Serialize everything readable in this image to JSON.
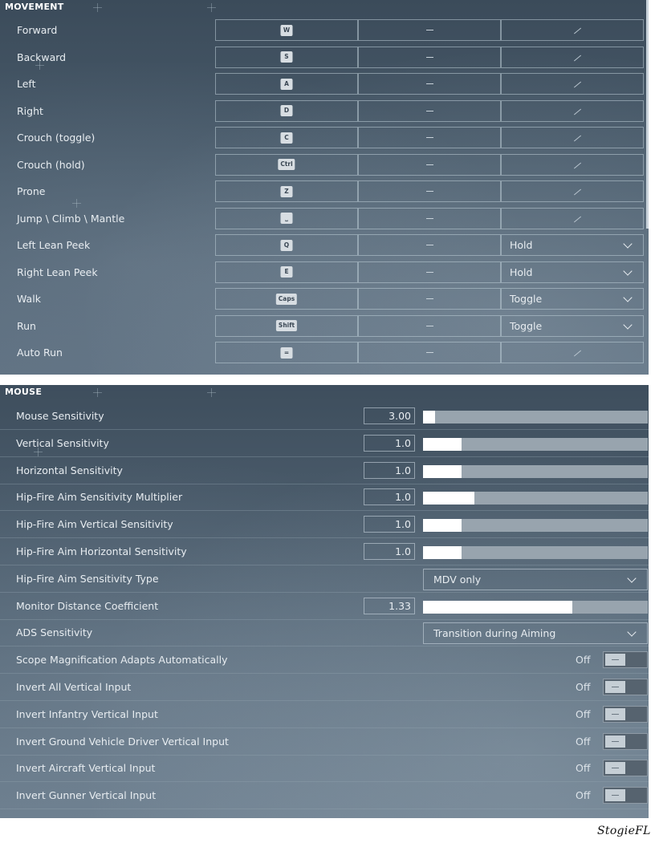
{
  "movement": {
    "title": "MOVEMENT",
    "rows": [
      {
        "label": "Forward",
        "key": "W",
        "secondary": "—",
        "third": "/"
      },
      {
        "label": "Backward",
        "key": "S",
        "secondary": "—",
        "third": "/"
      },
      {
        "label": "Left",
        "key": "A",
        "secondary": "—",
        "third": "/"
      },
      {
        "label": "Right",
        "key": "D",
        "secondary": "—",
        "third": "/"
      },
      {
        "label": "Crouch (toggle)",
        "key": "C",
        "secondary": "—",
        "third": "/"
      },
      {
        "label": "Crouch (hold)",
        "key": "Ctrl",
        "secondary": "—",
        "third": "/"
      },
      {
        "label": "Prone",
        "key": "Z",
        "secondary": "—",
        "third": "/"
      },
      {
        "label": "Jump \\ Climb \\ Mantle",
        "key": "⎵",
        "secondary": "—",
        "third": "/"
      },
      {
        "label": "Left Lean Peek",
        "key": "Q",
        "secondary": "—",
        "mode": "Hold"
      },
      {
        "label": "Right Lean Peek",
        "key": "E",
        "secondary": "—",
        "mode": "Hold"
      },
      {
        "label": "Walk",
        "key": "Caps",
        "secondary": "—",
        "mode": "Toggle"
      },
      {
        "label": "Run",
        "key": "Shift",
        "secondary": "—",
        "mode": "Toggle"
      },
      {
        "label": "Auto Run",
        "key": "=",
        "secondary": "—",
        "third": "/"
      }
    ]
  },
  "mouse": {
    "title": "MOUSE",
    "rows": [
      {
        "label": "Mouse Sensitivity",
        "value": "3.00",
        "level": 0.055
      },
      {
        "label": "Vertical Sensitivity",
        "value": "1.0",
        "level": 0.17
      },
      {
        "label": "Horizontal Sensitivity",
        "value": "1.0",
        "level": 0.17
      },
      {
        "label": "Hip-Fire Aim Sensitivity Multiplier",
        "value": "1.0",
        "level": 0.23
      },
      {
        "label": "Hip-Fire Aim Vertical Sensitivity",
        "value": "1.0",
        "level": 0.17
      },
      {
        "label": "Hip-Fire Aim Horizontal Sensitivity",
        "value": "1.0",
        "level": 0.17
      },
      {
        "label": "Hip-Fire Aim Sensitivity Type",
        "option": "MDV only"
      },
      {
        "label": "Monitor Distance Coefficient",
        "value": "1.33",
        "level": 0.665
      },
      {
        "label": "ADS Sensitivity",
        "option": "Transition during Aiming"
      },
      {
        "label": "Scope Magnification Adapts Automatically",
        "state": "Off"
      },
      {
        "label": "Invert All Vertical Input",
        "state": "Off"
      },
      {
        "label": "Invert Infantry Vertical Input",
        "state": "Off"
      },
      {
        "label": "Invert Ground Vehicle Driver Vertical Input",
        "state": "Off"
      },
      {
        "label": "Invert Aircraft Vertical Input",
        "state": "Off"
      },
      {
        "label": "Invert Gunner Vertical Input",
        "state": "Off"
      }
    ]
  },
  "signature": "StogieFL",
  "colors": {
    "slider_fill": "#ffffff",
    "slider_track": "#98a4ae"
  }
}
